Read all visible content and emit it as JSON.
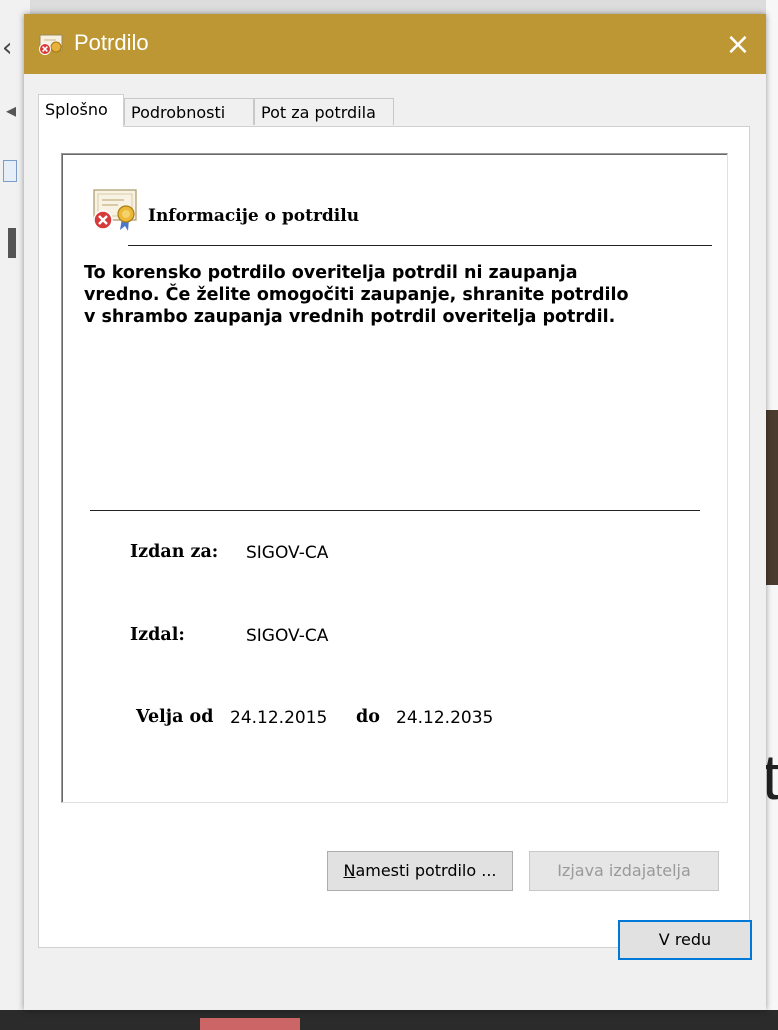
{
  "window": {
    "title": "Potrdilo",
    "close_icon": "×"
  },
  "tabs": [
    {
      "label": "Splošno",
      "active": true
    },
    {
      "label": "Podrobnosti",
      "active": false
    },
    {
      "label": "Pot za potrdila",
      "active": false
    }
  ],
  "general": {
    "heading": "Informacije o potrdilu",
    "warning_lines": [
      "To korensko potrdilo overitelja potrdil ni zaupanja",
      "vredno. Če želite omogočiti zaupanje, shranite potrdilo",
      "v shrambo zaupanja vrednih potrdil overitelja potrdil."
    ],
    "issued_to_label": "Izdan za:",
    "issued_to_value": "SIGOV-CA",
    "issued_by_label": "Izdal:",
    "issued_by_value": "SIGOV-CA",
    "valid_from_label": "Velja od",
    "valid_from_value": "24.12.2015",
    "valid_to_label": "do",
    "valid_to_value": "24.12.2035"
  },
  "buttons": {
    "install_first": "N",
    "install_rest": "amesti potrdilo ...",
    "issuer_statement": "Izjava izdajatelja",
    "ok": "V redu"
  },
  "colors": {
    "titlebar": "#bd9733",
    "default_button_border": "#0078d7"
  }
}
